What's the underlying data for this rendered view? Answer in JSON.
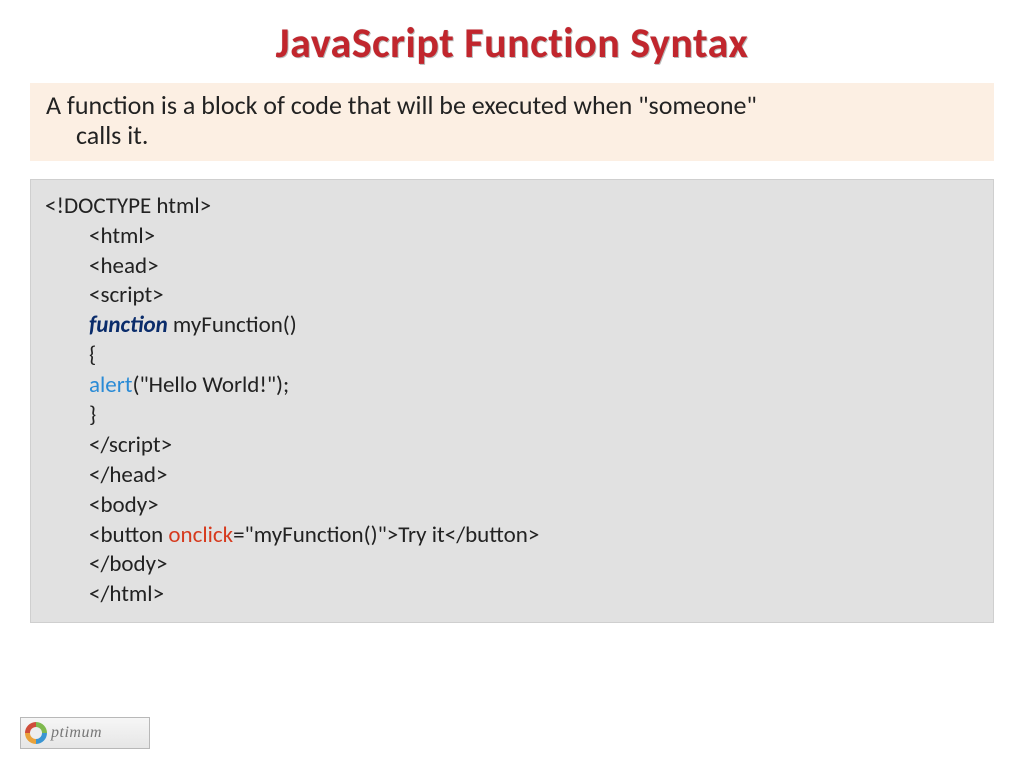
{
  "title": "JavaScript Function Syntax",
  "description": {
    "line1": "A function is a block of code that will be executed when \"someone\"",
    "line2": "calls it."
  },
  "code": {
    "l1": "<!DOCTYPE html>",
    "l2": "<html>",
    "l3": "<head>",
    "l4": "<script>",
    "l5_kw": "function",
    "l5_rest": " myFunction()",
    "l6": "{",
    "l7_fn": "alert",
    "l7_rest": "(\"Hello World!\");",
    "l8": "}",
    "l9": "</script>",
    "l10": "</head>",
    "l11": "<body>",
    "l12_a": "<button ",
    "l12_attr": "onclick",
    "l12_b": "=\"myFunction()\">Try it</button>",
    "l13": "</body>",
    "l14": "</html>"
  },
  "logo": {
    "text": "ptimum"
  }
}
